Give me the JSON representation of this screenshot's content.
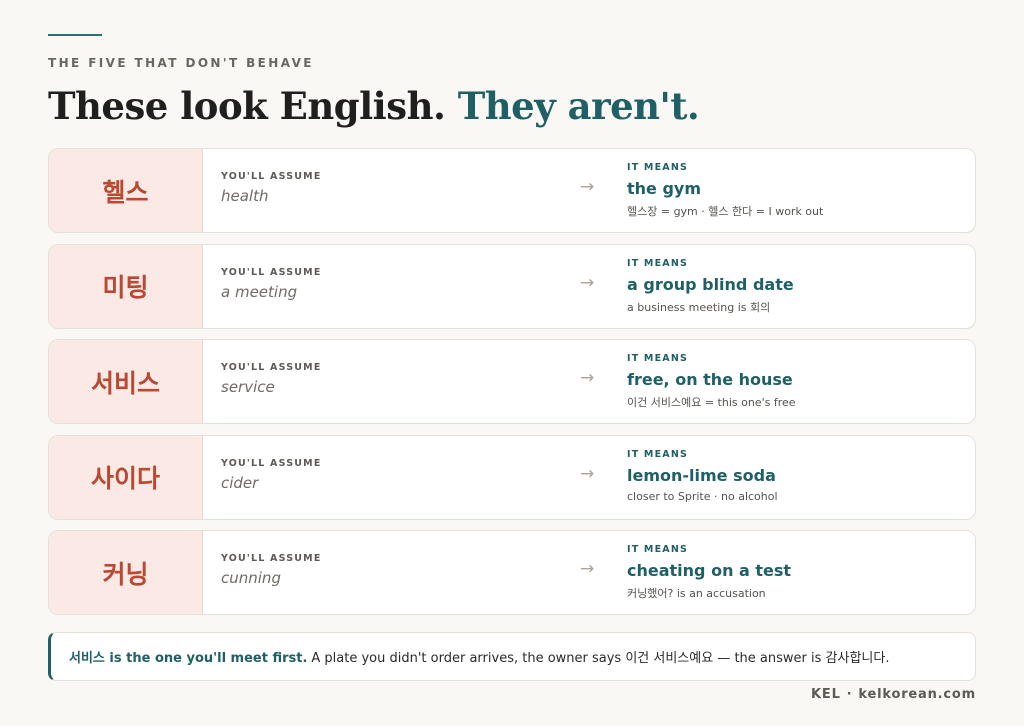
{
  "header": {
    "eyebrow": "THE FIVE THAT DON'T BEHAVE",
    "title_main": "These look English.",
    "title_accent": "They aren't."
  },
  "labels": {
    "assume": "YOU'LL ASSUME",
    "means": "IT MEANS",
    "arrow": "→"
  },
  "cards": [
    {
      "korean": "헬스",
      "assume": "health",
      "means": "the gym",
      "note": "헬스장 = gym · 헬스 한다 = I work out"
    },
    {
      "korean": "미팅",
      "assume": "a meeting",
      "means": "a group blind date",
      "note": "a business meeting is 회의"
    },
    {
      "korean": "서비스",
      "assume": "service",
      "means": "free, on the house",
      "note": "이건 서비스예요 = this one's free"
    },
    {
      "korean": "사이다",
      "assume": "cider",
      "means": "lemon-lime soda",
      "note": "closer to Sprite · no alcohol"
    },
    {
      "korean": "커닝",
      "assume": "cunning",
      "means": "cheating on a test",
      "note": "커닝했어? is an accusation"
    }
  ],
  "callout": {
    "lead": "서비스 is the one you'll meet first.",
    "body": "A plate you didn't order arrives, the owner says 이건 서비스예요 — the answer is 감사합니다."
  },
  "footer": {
    "brand": "KEL",
    "separator": "·",
    "site": "kelkorean.com"
  },
  "colors": {
    "accent": "#1f5f66",
    "korean_text": "#b84a33",
    "korean_bg": "#fbe9e5",
    "background": "#faf8f5"
  }
}
